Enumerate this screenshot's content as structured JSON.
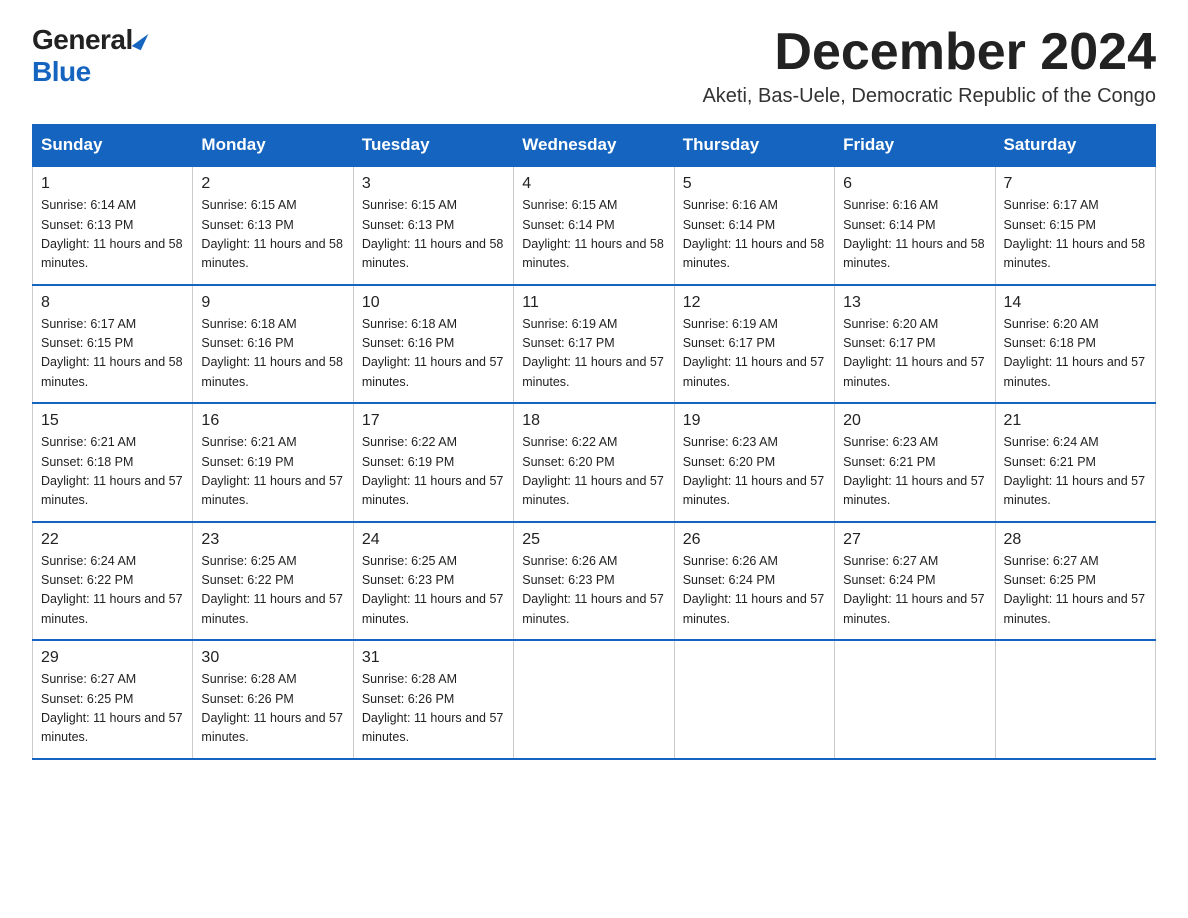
{
  "logo": {
    "general": "General",
    "blue": "Blue"
  },
  "title": "December 2024",
  "subtitle": "Aketi, Bas-Uele, Democratic Republic of the Congo",
  "days_of_week": [
    "Sunday",
    "Monday",
    "Tuesday",
    "Wednesday",
    "Thursday",
    "Friday",
    "Saturday"
  ],
  "weeks": [
    [
      {
        "day": "1",
        "sunrise": "6:14 AM",
        "sunset": "6:13 PM",
        "daylight": "11 hours and 58 minutes."
      },
      {
        "day": "2",
        "sunrise": "6:15 AM",
        "sunset": "6:13 PM",
        "daylight": "11 hours and 58 minutes."
      },
      {
        "day": "3",
        "sunrise": "6:15 AM",
        "sunset": "6:13 PM",
        "daylight": "11 hours and 58 minutes."
      },
      {
        "day": "4",
        "sunrise": "6:15 AM",
        "sunset": "6:14 PM",
        "daylight": "11 hours and 58 minutes."
      },
      {
        "day": "5",
        "sunrise": "6:16 AM",
        "sunset": "6:14 PM",
        "daylight": "11 hours and 58 minutes."
      },
      {
        "day": "6",
        "sunrise": "6:16 AM",
        "sunset": "6:14 PM",
        "daylight": "11 hours and 58 minutes."
      },
      {
        "day": "7",
        "sunrise": "6:17 AM",
        "sunset": "6:15 PM",
        "daylight": "11 hours and 58 minutes."
      }
    ],
    [
      {
        "day": "8",
        "sunrise": "6:17 AM",
        "sunset": "6:15 PM",
        "daylight": "11 hours and 58 minutes."
      },
      {
        "day": "9",
        "sunrise": "6:18 AM",
        "sunset": "6:16 PM",
        "daylight": "11 hours and 58 minutes."
      },
      {
        "day": "10",
        "sunrise": "6:18 AM",
        "sunset": "6:16 PM",
        "daylight": "11 hours and 57 minutes."
      },
      {
        "day": "11",
        "sunrise": "6:19 AM",
        "sunset": "6:17 PM",
        "daylight": "11 hours and 57 minutes."
      },
      {
        "day": "12",
        "sunrise": "6:19 AM",
        "sunset": "6:17 PM",
        "daylight": "11 hours and 57 minutes."
      },
      {
        "day": "13",
        "sunrise": "6:20 AM",
        "sunset": "6:17 PM",
        "daylight": "11 hours and 57 minutes."
      },
      {
        "day": "14",
        "sunrise": "6:20 AM",
        "sunset": "6:18 PM",
        "daylight": "11 hours and 57 minutes."
      }
    ],
    [
      {
        "day": "15",
        "sunrise": "6:21 AM",
        "sunset": "6:18 PM",
        "daylight": "11 hours and 57 minutes."
      },
      {
        "day": "16",
        "sunrise": "6:21 AM",
        "sunset": "6:19 PM",
        "daylight": "11 hours and 57 minutes."
      },
      {
        "day": "17",
        "sunrise": "6:22 AM",
        "sunset": "6:19 PM",
        "daylight": "11 hours and 57 minutes."
      },
      {
        "day": "18",
        "sunrise": "6:22 AM",
        "sunset": "6:20 PM",
        "daylight": "11 hours and 57 minutes."
      },
      {
        "day": "19",
        "sunrise": "6:23 AM",
        "sunset": "6:20 PM",
        "daylight": "11 hours and 57 minutes."
      },
      {
        "day": "20",
        "sunrise": "6:23 AM",
        "sunset": "6:21 PM",
        "daylight": "11 hours and 57 minutes."
      },
      {
        "day": "21",
        "sunrise": "6:24 AM",
        "sunset": "6:21 PM",
        "daylight": "11 hours and 57 minutes."
      }
    ],
    [
      {
        "day": "22",
        "sunrise": "6:24 AM",
        "sunset": "6:22 PM",
        "daylight": "11 hours and 57 minutes."
      },
      {
        "day": "23",
        "sunrise": "6:25 AM",
        "sunset": "6:22 PM",
        "daylight": "11 hours and 57 minutes."
      },
      {
        "day": "24",
        "sunrise": "6:25 AM",
        "sunset": "6:23 PM",
        "daylight": "11 hours and 57 minutes."
      },
      {
        "day": "25",
        "sunrise": "6:26 AM",
        "sunset": "6:23 PM",
        "daylight": "11 hours and 57 minutes."
      },
      {
        "day": "26",
        "sunrise": "6:26 AM",
        "sunset": "6:24 PM",
        "daylight": "11 hours and 57 minutes."
      },
      {
        "day": "27",
        "sunrise": "6:27 AM",
        "sunset": "6:24 PM",
        "daylight": "11 hours and 57 minutes."
      },
      {
        "day": "28",
        "sunrise": "6:27 AM",
        "sunset": "6:25 PM",
        "daylight": "11 hours and 57 minutes."
      }
    ],
    [
      {
        "day": "29",
        "sunrise": "6:27 AM",
        "sunset": "6:25 PM",
        "daylight": "11 hours and 57 minutes."
      },
      {
        "day": "30",
        "sunrise": "6:28 AM",
        "sunset": "6:26 PM",
        "daylight": "11 hours and 57 minutes."
      },
      {
        "day": "31",
        "sunrise": "6:28 AM",
        "sunset": "6:26 PM",
        "daylight": "11 hours and 57 minutes."
      },
      null,
      null,
      null,
      null
    ]
  ]
}
